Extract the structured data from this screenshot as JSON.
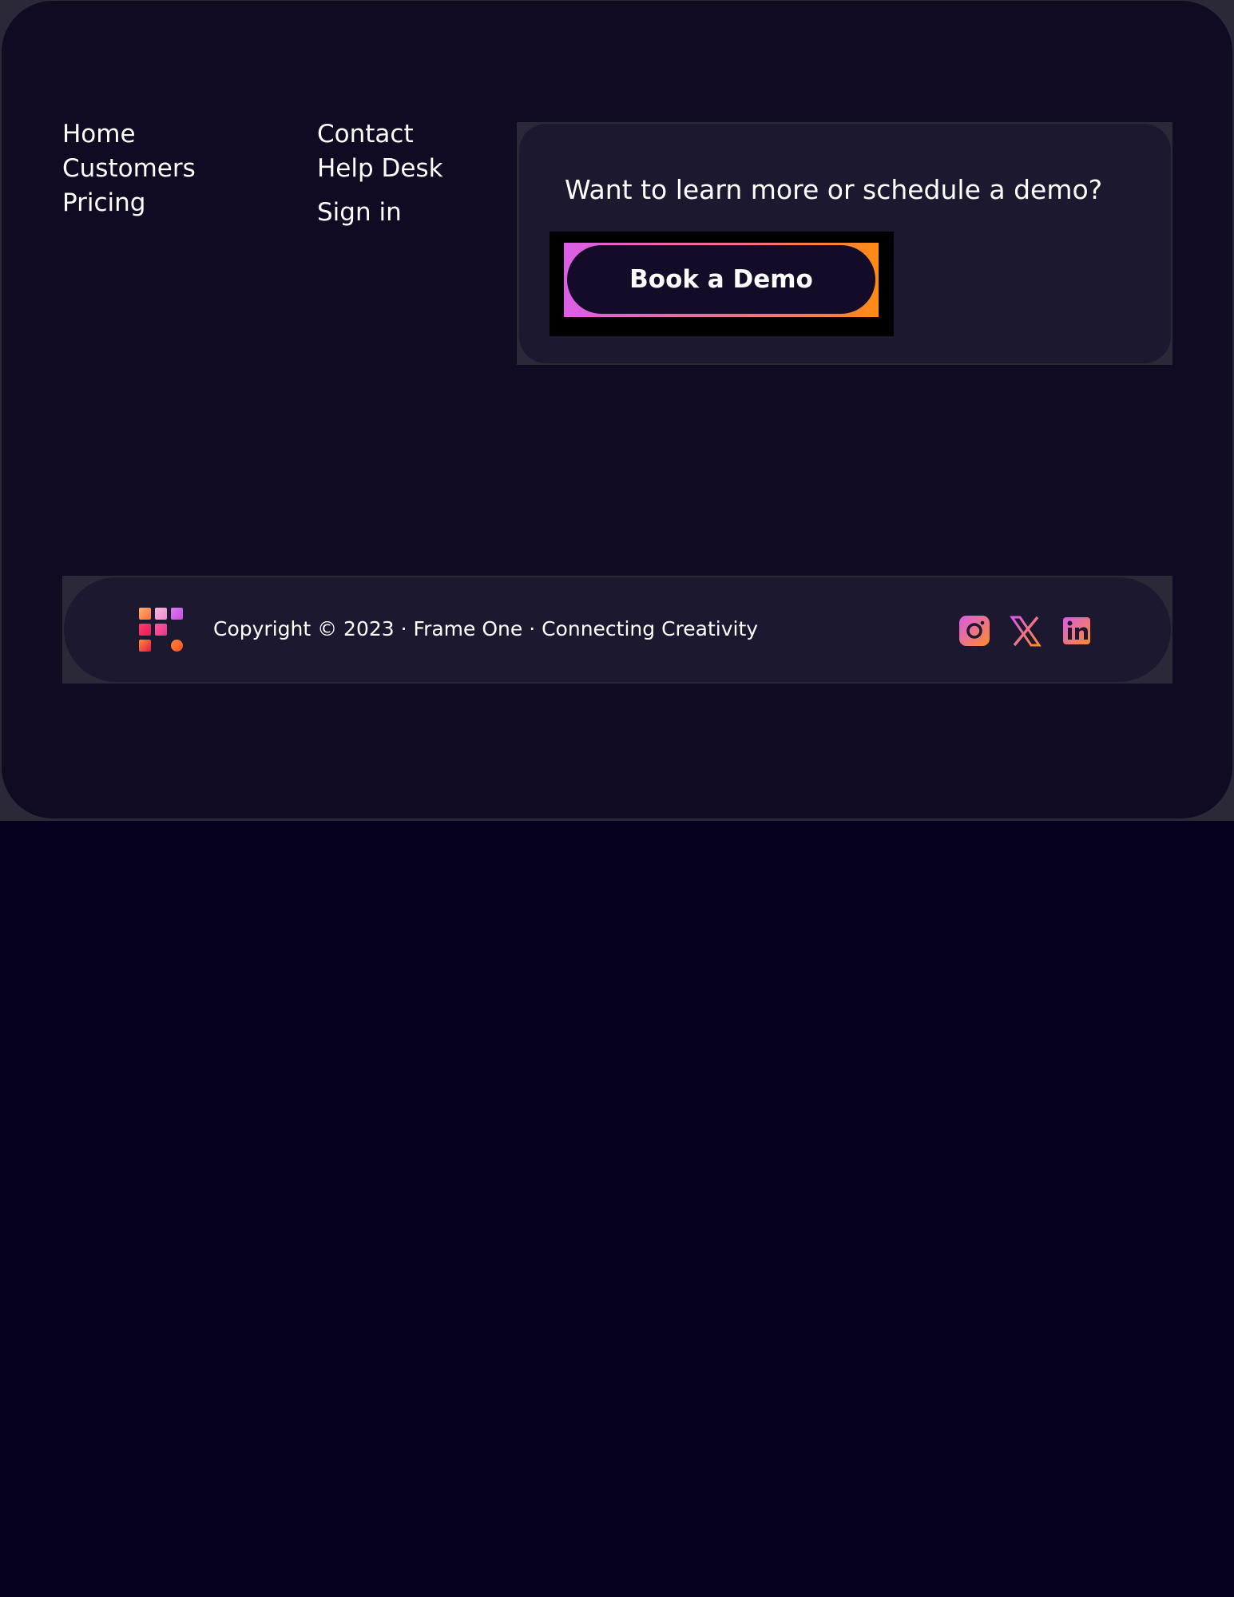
{
  "nav": {
    "column1": [
      "Home",
      "Customers",
      "Pricing"
    ],
    "column2": [
      "Contact",
      "Help Desk"
    ],
    "sign_in": "Sign in"
  },
  "cta": {
    "heading": "Want to learn more or schedule a demo?",
    "button_label": "Book a Demo"
  },
  "footer": {
    "copyright": "Copyright © 2023 · Frame One · Connecting Creativity",
    "logo_icon": "frame-one-logo-icon",
    "social": [
      {
        "icon": "instagram-icon"
      },
      {
        "icon": "x-twitter-icon"
      },
      {
        "icon": "linkedin-icon"
      }
    ]
  },
  "colors": {
    "page_background": "#05001d",
    "card_background": "#100b23",
    "panel_background": "#1c1830",
    "gradient_start": "#da5fe6",
    "gradient_end": "#ff8a14"
  }
}
